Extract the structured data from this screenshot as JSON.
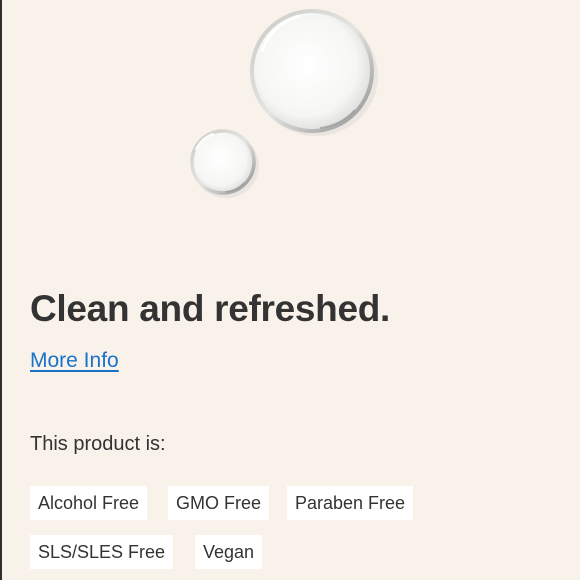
{
  "headline": "Clean and refreshed.",
  "more_info_link": "More Info",
  "attributes": {
    "heading": "This product is:",
    "tags": [
      "Alcohol Free",
      "GMO Free",
      "Paraben Free",
      "SLS/SLES Free",
      "Vegan"
    ]
  },
  "colors": {
    "background": "#f9f2ea",
    "text": "#333333",
    "link": "#1a73c9",
    "tag_background": "#ffffff"
  }
}
